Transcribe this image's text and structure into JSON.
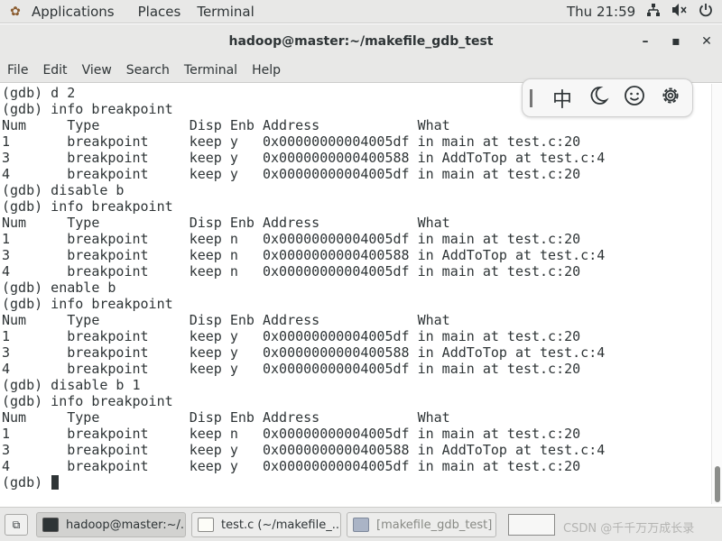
{
  "top_bar": {
    "applications_label": "Applications",
    "places_label": "Places",
    "terminal_label": "Terminal",
    "clock": "Thu 21:59",
    "tray_icons": [
      "network-icon",
      "volume-icon",
      "power-icon"
    ]
  },
  "window": {
    "title": "hadoop@master:~/makefile_gdb_test"
  },
  "menubar": {
    "file": "File",
    "edit": "Edit",
    "view": "View",
    "search": "Search",
    "terminal": "Terminal",
    "help": "Help"
  },
  "terminal": {
    "lines": [
      "(gdb) d 2",
      "(gdb) info breakpoint",
      "Num     Type           Disp Enb Address            What",
      "1       breakpoint     keep y   0x00000000004005df in main at test.c:20",
      "3       breakpoint     keep y   0x0000000000400588 in AddToTop at test.c:4",
      "4       breakpoint     keep y   0x00000000004005df in main at test.c:20",
      "(gdb) disable b",
      "(gdb) info breakpoint",
      "Num     Type           Disp Enb Address            What",
      "1       breakpoint     keep n   0x00000000004005df in main at test.c:20",
      "3       breakpoint     keep n   0x0000000000400588 in AddToTop at test.c:4",
      "4       breakpoint     keep n   0x00000000004005df in main at test.c:20",
      "(gdb) enable b",
      "(gdb) info breakpoint",
      "Num     Type           Disp Enb Address            What",
      "1       breakpoint     keep y   0x00000000004005df in main at test.c:20",
      "3       breakpoint     keep y   0x0000000000400588 in AddToTop at test.c:4",
      "4       breakpoint     keep y   0x00000000004005df in main at test.c:20",
      "(gdb) disable b 1",
      "(gdb) info breakpoint",
      "Num     Type           Disp Enb Address            What",
      "1       breakpoint     keep n   0x00000000004005df in main at test.c:20",
      "3       breakpoint     keep y   0x0000000000400588 in AddToTop at test.c:4",
      "4       breakpoint     keep y   0x00000000004005df in main at test.c:20"
    ],
    "prompt": "(gdb) "
  },
  "ime_toolbar": {
    "chinese_mode_label": "中",
    "icons": [
      "moon-icon",
      "emoji-icon",
      "settings-icon"
    ]
  },
  "taskbar": {
    "tasks": [
      {
        "label": "hadoop@master:~/...",
        "icon": "terminal-icon"
      },
      {
        "label": "test.c (~/makefile_...",
        "icon": "text-editor-icon"
      },
      {
        "label": "[makefile_gdb_test]",
        "icon": "file-manager-icon"
      }
    ],
    "watermark": "CSDN @千千万万成长录"
  },
  "colors": {
    "chrome_bg": "#e8e8e7",
    "terminal_bg": "#ffffff",
    "terminal_fg": "#2e3436"
  }
}
